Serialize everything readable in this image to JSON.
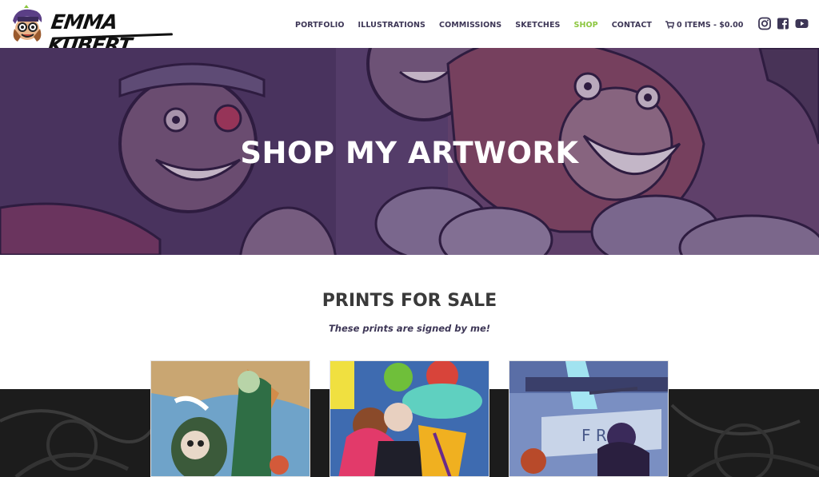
{
  "logo": {
    "text": "EMMA KUBERT"
  },
  "nav": {
    "items": [
      {
        "label": "PORTFOLIO",
        "active": false
      },
      {
        "label": "ILLUSTRATIONS",
        "active": false
      },
      {
        "label": "COMMISSIONS",
        "active": false
      },
      {
        "label": "SKETCHES",
        "active": false
      },
      {
        "label": "SHOP",
        "active": true
      },
      {
        "label": "CONTACT",
        "active": false
      }
    ],
    "cart_label": "0 ITEMS - $0.00",
    "cart_icon": "cart-icon",
    "active_color": "#8cc63f"
  },
  "social": [
    {
      "icon": "instagram-icon"
    },
    {
      "icon": "facebook-icon"
    },
    {
      "icon": "youtube-icon"
    }
  ],
  "hero": {
    "title": "SHOP MY ARTWORK"
  },
  "prints": {
    "title": "PRINTS FOR SALE",
    "subtitle": "These prints are signed by me!"
  },
  "colors": {
    "accent": "#8cc63f",
    "nav_text": "#3d3656",
    "hero_tint": "#5a3f6e"
  }
}
